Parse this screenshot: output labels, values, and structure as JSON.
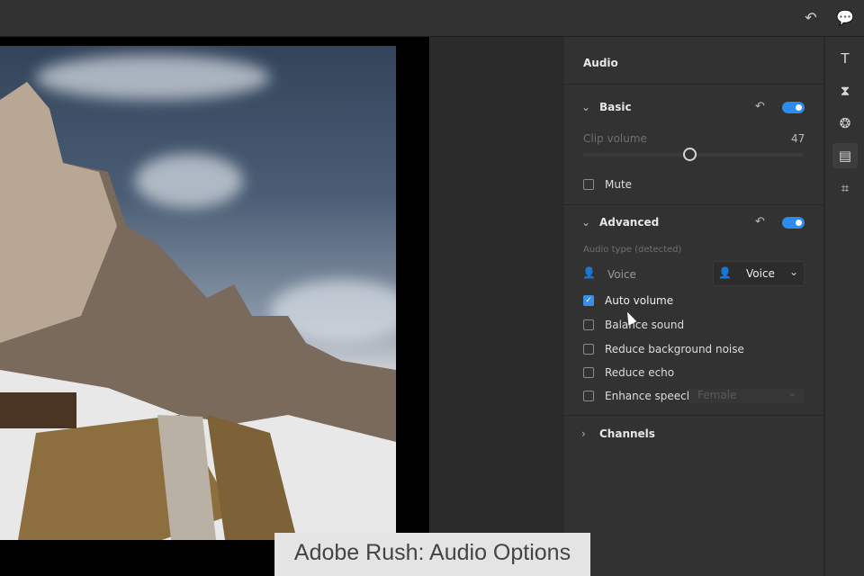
{
  "topbar": {
    "undo_icon": "undo-icon",
    "comment_icon": "comment-icon"
  },
  "panel": {
    "title": "Audio",
    "basic": {
      "label": "Basic",
      "clip_volume_label": "Clip volume",
      "clip_volume_value": "47",
      "clip_volume": 47,
      "mute_label": "Mute",
      "mute_checked": false,
      "enabled": true
    },
    "advanced": {
      "label": "Advanced",
      "enabled": true,
      "audio_type_label": "Audio type (detected)",
      "detected_type": "Voice",
      "type_select": "Voice",
      "options": [
        {
          "label": "Auto volume",
          "checked": true
        },
        {
          "label": "Balance sound",
          "checked": false
        },
        {
          "label": "Reduce background noise",
          "checked": false
        },
        {
          "label": "Reduce echo",
          "checked": false
        },
        {
          "label": "Enhance speech",
          "checked": false
        }
      ],
      "enhance_speech_select": "Female"
    },
    "channels": {
      "label": "Channels"
    }
  },
  "tools": [
    "titles",
    "transitions",
    "color",
    "audio",
    "crop"
  ],
  "caption": "Adobe Rush: Audio Options",
  "colors": {
    "accent": "#2d8ceb",
    "panel": "#323232"
  }
}
